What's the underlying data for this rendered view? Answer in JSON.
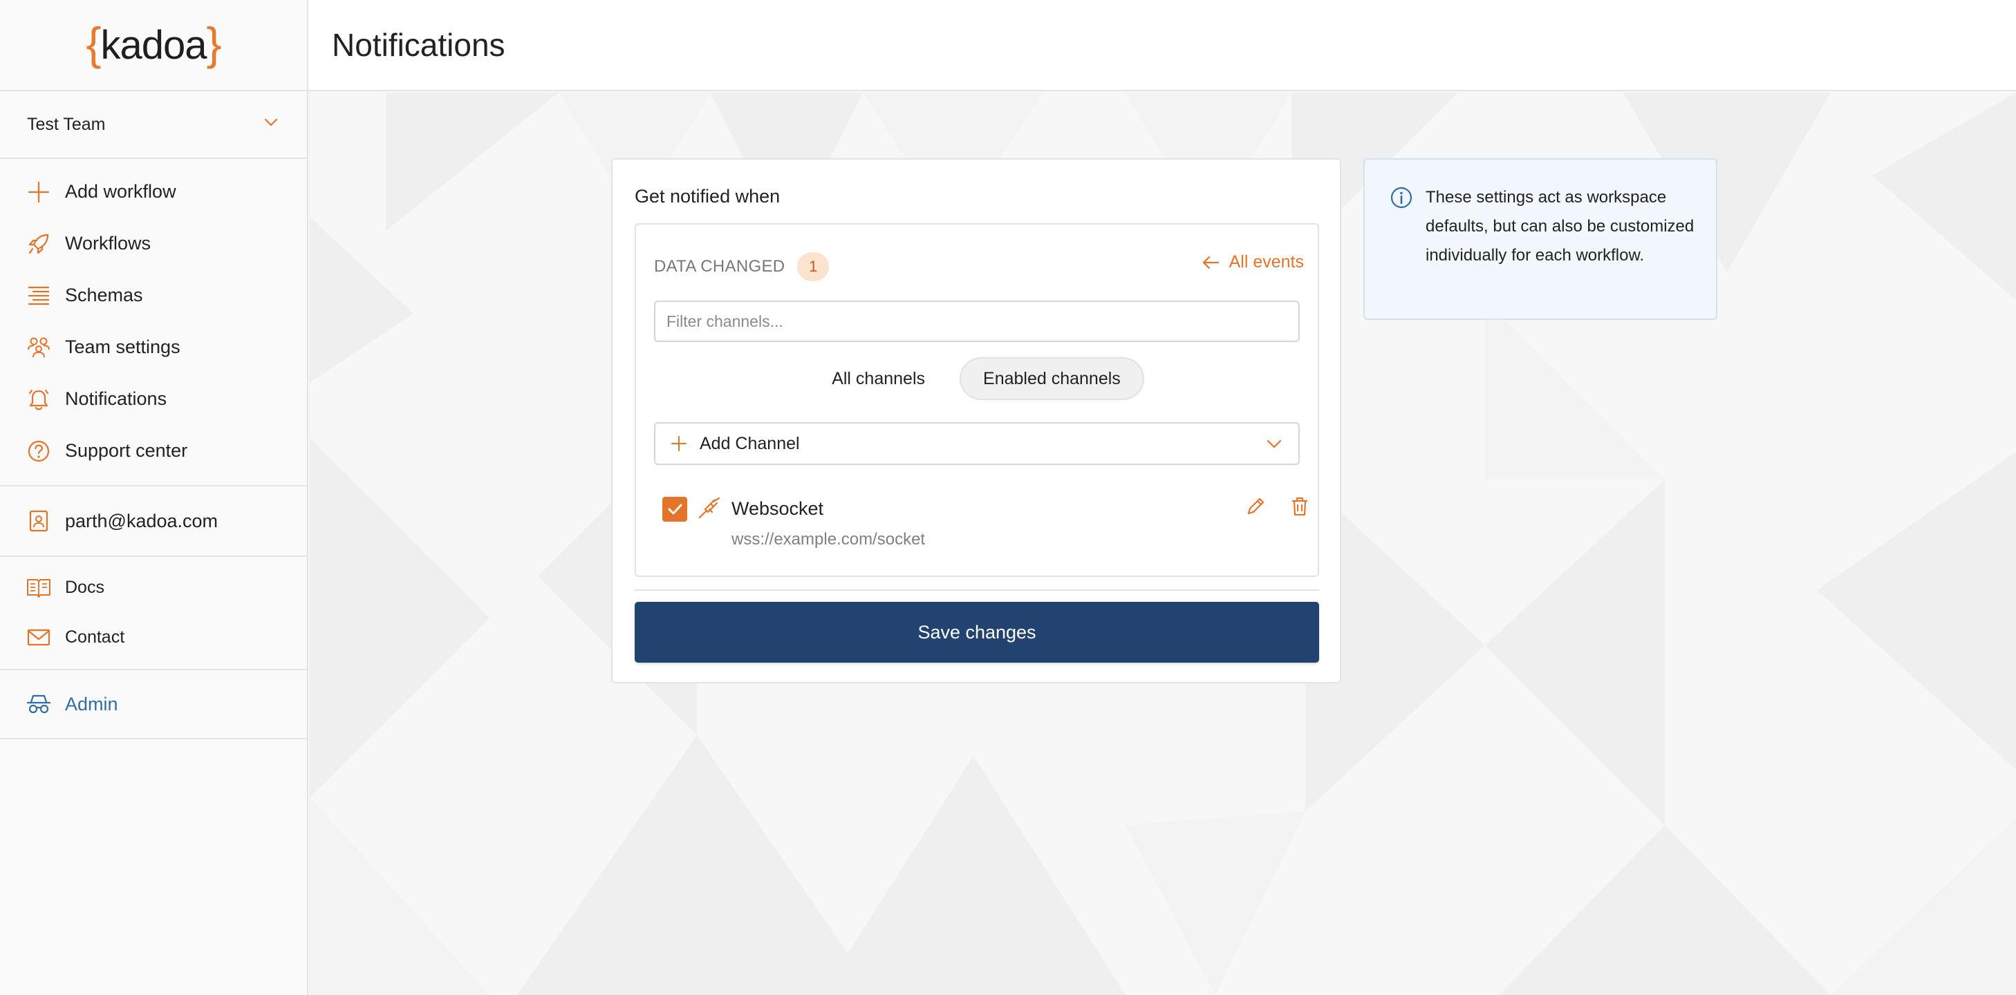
{
  "app": {
    "logo_text": "kadoa",
    "accent_color": "#e87a2d",
    "primary_color": "#224270",
    "link_color": "#2e6ea6"
  },
  "sidebar": {
    "team": "Test Team",
    "nav": [
      {
        "label": "Add workflow",
        "icon": "plus-icon"
      },
      {
        "label": "Workflows",
        "icon": "rocket-icon"
      },
      {
        "label": "Schemas",
        "icon": "schema-list-icon"
      },
      {
        "label": "Team settings",
        "icon": "team-icon"
      },
      {
        "label": "Notifications",
        "icon": "bell-icon"
      },
      {
        "label": "Support center",
        "icon": "help-circle-icon"
      }
    ],
    "user_email": "parth@kadoa.com",
    "docs_label": "Docs",
    "contact_label": "Contact",
    "admin_label": "Admin"
  },
  "header": {
    "title": "Notifications"
  },
  "notify": {
    "title": "Get notified when",
    "event_label": "DATA CHANGED",
    "event_count": "1",
    "all_events_label": "All events",
    "filter_placeholder": "Filter channels...",
    "tabs": {
      "all": "All channels",
      "enabled": "Enabled channels",
      "active": "enabled"
    },
    "add_channel_label": "Add Channel",
    "channels": [
      {
        "name": "Websocket",
        "url": "wss://example.com/socket",
        "checked": true
      }
    ],
    "save_label": "Save changes"
  },
  "info": {
    "text": "These settings act as workspace defaults, but can also be customized individually for each workflow."
  }
}
